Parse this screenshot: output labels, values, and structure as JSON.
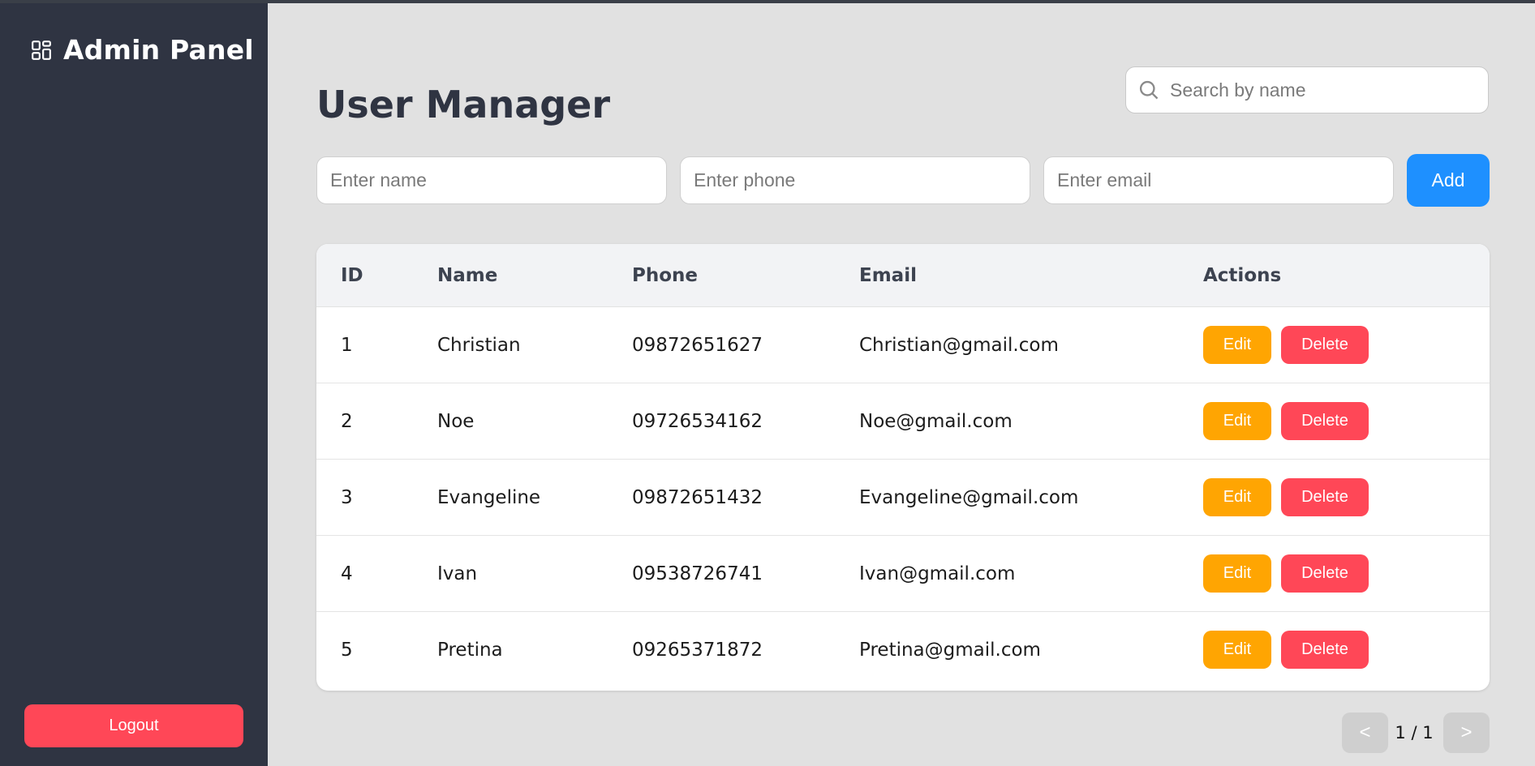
{
  "sidebar": {
    "brand_title": "Admin Panel",
    "brand_icon": "dashboard-grid-icon",
    "logout_label": "Logout"
  },
  "main": {
    "title": "User Manager",
    "search": {
      "placeholder": "Search by name",
      "value": ""
    },
    "form": {
      "name_placeholder": "Enter name",
      "phone_placeholder": "Enter phone",
      "email_placeholder": "Enter email",
      "add_label": "Add"
    },
    "table": {
      "headers": {
        "id": "ID",
        "name": "Name",
        "phone": "Phone",
        "email": "Email",
        "actions": "Actions"
      },
      "edit_label": "Edit",
      "delete_label": "Delete",
      "rows": [
        {
          "id": "1",
          "name": "Christian",
          "phone": "09872651627",
          "email": "Christian@gmail.com"
        },
        {
          "id": "2",
          "name": "Noe",
          "phone": "09726534162",
          "email": "Noe@gmail.com"
        },
        {
          "id": "3",
          "name": "Evangeline",
          "phone": "09872651432",
          "email": "Evangeline@gmail.com"
        },
        {
          "id": "4",
          "name": "Ivan",
          "phone": "09538726741",
          "email": "Ivan@gmail.com"
        },
        {
          "id": "5",
          "name": "Pretina",
          "phone": "09265371872",
          "email": "Pretina@gmail.com"
        }
      ]
    },
    "pagination": {
      "prev_label": "<",
      "page_text": "1 / 1",
      "next_label": ">"
    }
  },
  "colors": {
    "sidebar_bg": "#2f3442",
    "page_bg": "#e1e1e1",
    "primary": "#1e90ff",
    "edit": "#ffa502",
    "danger": "#ff4757"
  }
}
